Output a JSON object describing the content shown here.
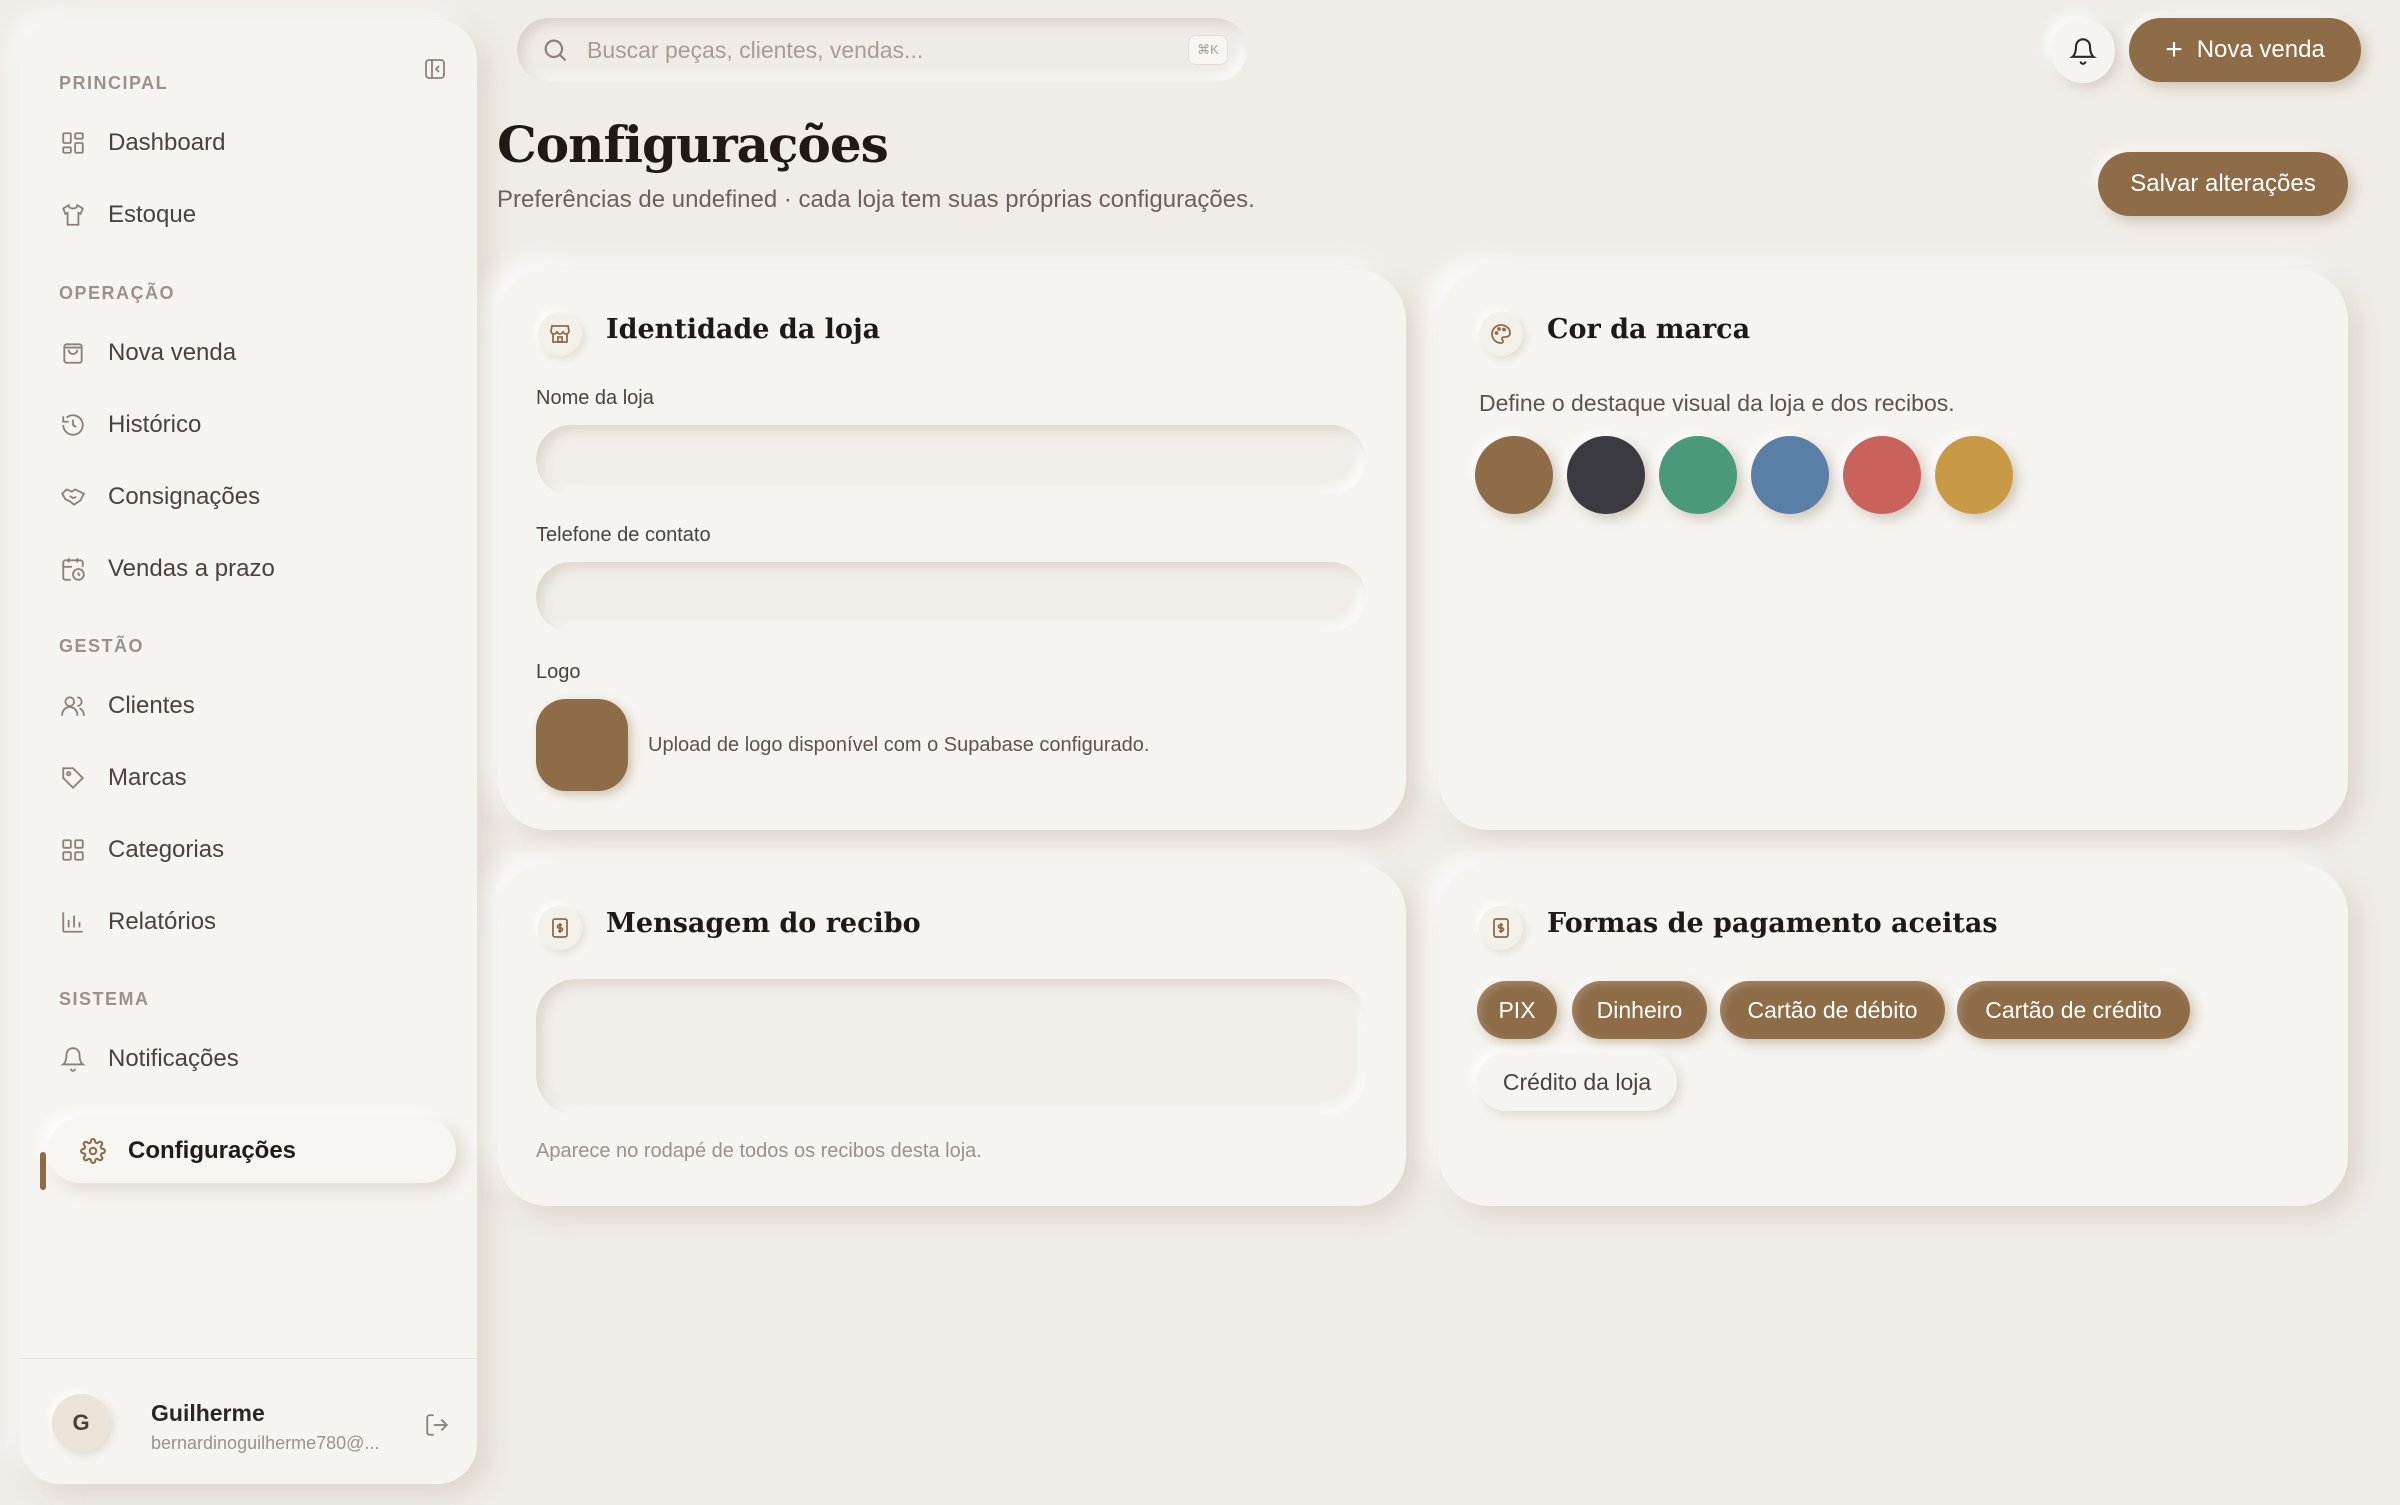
{
  "search": {
    "placeholder": "Buscar peças, clientes, vendas...",
    "shortcut": "⌘K"
  },
  "header": {
    "new_sale_label": "Nova venda"
  },
  "sidebar": {
    "sections": [
      {
        "label": "PRINCIPAL"
      },
      {
        "label": "OPERAÇÃO"
      },
      {
        "label": "GESTÃO"
      },
      {
        "label": "SISTEMA"
      }
    ],
    "items": [
      {
        "label": "Dashboard",
        "icon": "dashboard-icon"
      },
      {
        "label": "Estoque",
        "icon": "shirt-icon"
      },
      {
        "label": "Nova venda",
        "icon": "shopping-bag-icon"
      },
      {
        "label": "Histórico",
        "icon": "history-icon"
      },
      {
        "label": "Consignações",
        "icon": "handshake-icon"
      },
      {
        "label": "Vendas a prazo",
        "icon": "calendar-clock-icon"
      },
      {
        "label": "Clientes",
        "icon": "users-icon"
      },
      {
        "label": "Marcas",
        "icon": "tag-icon"
      },
      {
        "label": "Categorias",
        "icon": "grid-icon"
      },
      {
        "label": "Relatórios",
        "icon": "bar-chart-icon"
      },
      {
        "label": "Notificações",
        "icon": "bell-icon"
      },
      {
        "label": "Configurações",
        "icon": "gear-icon",
        "active": true
      }
    ],
    "user": {
      "initial": "G",
      "name": "Guilherme",
      "email": "bernardinoguilherme780@..."
    }
  },
  "page": {
    "title": "Configurações",
    "subtitle": "Preferências de undefined · cada loja tem suas próprias configurações.",
    "save_label": "Salvar alterações"
  },
  "identity": {
    "title": "Identidade da loja",
    "store_name_label": "Nome da loja",
    "store_name_value": "",
    "phone_label": "Telefone de contato",
    "phone_value": "",
    "logo_label": "Logo",
    "logo_note": "Upload de logo disponível com o Supabase configurado."
  },
  "brand": {
    "title": "Cor da marca",
    "description": "Define o destaque visual da loja e dos recibos.",
    "colors": [
      "#8e6c48",
      "#3a3a40",
      "#4a9a7a",
      "#5a7fa6",
      "#c9625a",
      "#c99a45"
    ]
  },
  "receipt": {
    "title": "Mensagem do recibo",
    "message": "",
    "helper": "Aparece no rodapé de todos os recibos desta loja."
  },
  "payments": {
    "title": "Formas de pagamento aceitas",
    "methods": [
      {
        "label": "PIX",
        "enabled": true
      },
      {
        "label": "Dinheiro",
        "enabled": true
      },
      {
        "label": "Cartão de débito",
        "enabled": true
      },
      {
        "label": "Cartão de crédito",
        "enabled": true
      },
      {
        "label": "Crédito da loja",
        "enabled": false
      }
    ]
  }
}
